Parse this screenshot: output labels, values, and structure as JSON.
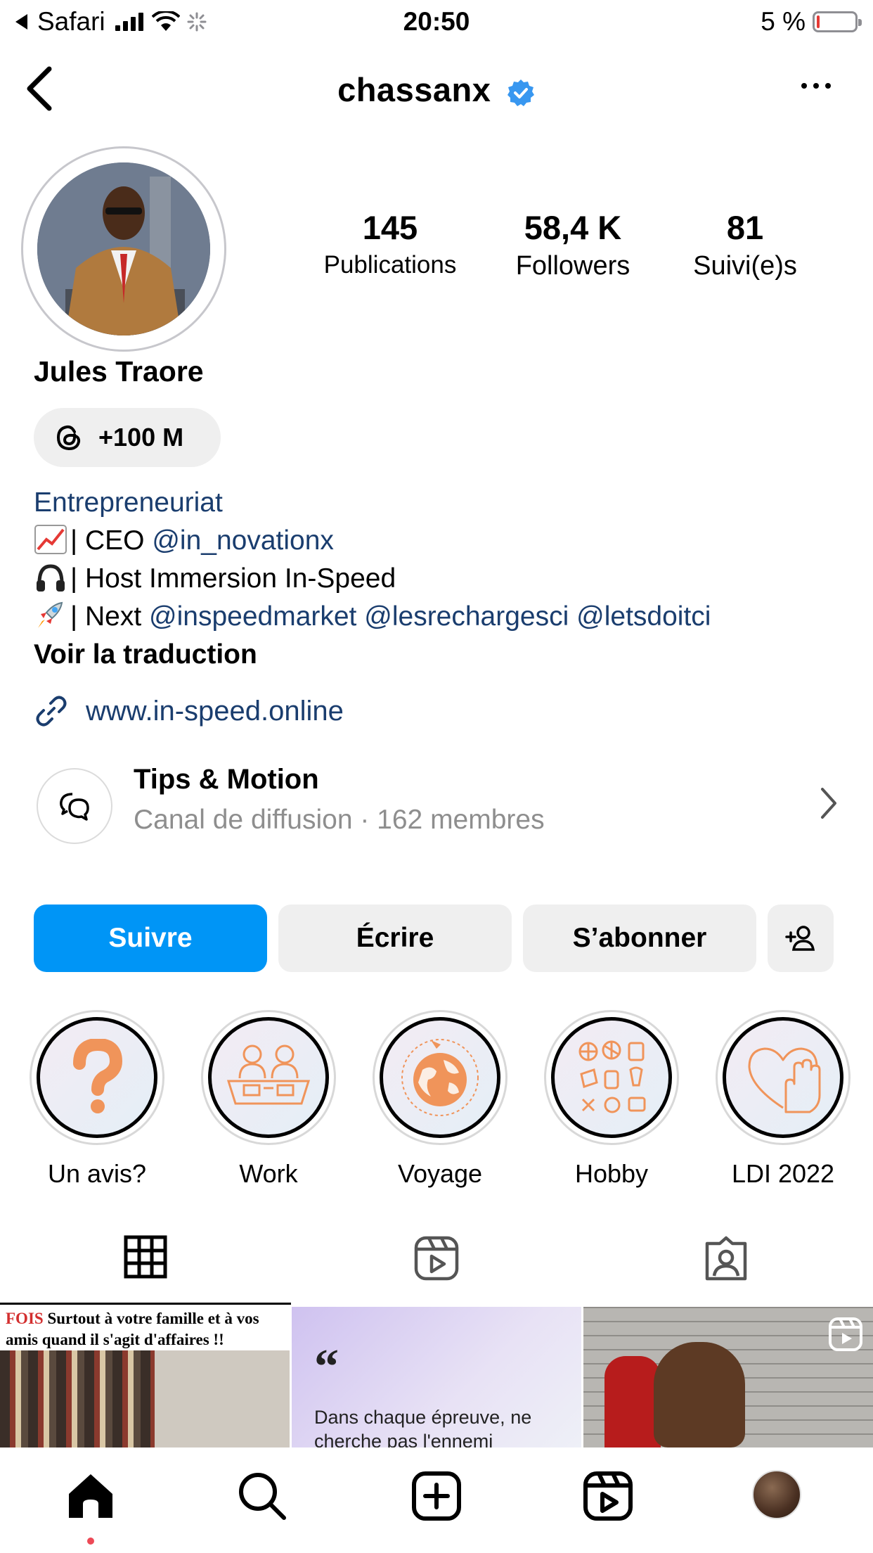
{
  "status_bar": {
    "carrier": "Safari",
    "time": "20:50",
    "battery_text": "5 %"
  },
  "header": {
    "username": "chassanx",
    "verified": true
  },
  "profile": {
    "stats": [
      {
        "value": "145",
        "label": "Publications"
      },
      {
        "value": "58,4 K",
        "label": "Followers"
      },
      {
        "value": "81",
        "label": "Suivi(e)s"
      }
    ],
    "full_name": "Jules Traore",
    "threads_badge": "+100 M",
    "bio": {
      "category": "Entrepreneuriat",
      "line1_prefix": "| CEO ",
      "line1_mention": "@in_novationx",
      "line2": "| Host Immersion In-Speed",
      "line3_prefix": "| Next ",
      "line3_mentions": [
        "@inspeedmarket",
        "@lesrechargesci",
        "@letsdoitci"
      ],
      "translate": "Voir la traduction"
    },
    "link": "www.in-speed.online",
    "channel": {
      "name": "Tips & Motion",
      "subtitle": "Canal de diffusion · 162 membres"
    }
  },
  "actions": {
    "follow": "Suivre",
    "message": "Écrire",
    "subscribe": "S’abonner"
  },
  "highlights": [
    {
      "label": "Un avis?",
      "icon": "question-mark-icon"
    },
    {
      "label": "Work",
      "icon": "meeting-table-icon"
    },
    {
      "label": "Voyage",
      "icon": "globe-plane-icon"
    },
    {
      "label": "Hobby",
      "icon": "sports-doodles-icon"
    },
    {
      "label": "LDI 2022",
      "icon": "heart-hand-icon"
    }
  ],
  "tabs": [
    "grid-icon",
    "reels-icon",
    "tagged-icon"
  ],
  "posts": [
    {
      "band_red": "FOIS",
      "band_text": " Surtout à votre famille et à vos amis quand il s'agit d'affaires !!"
    },
    {
      "quote_mark": "“",
      "text": "Dans chaque épreuve, ne cherche pas l'ennemi"
    },
    {
      "type": "reel"
    }
  ],
  "colors": {
    "primary_button": "#0095f6",
    "link_blue": "#1a3d6e",
    "secondary_button": "#efefef",
    "muted_text": "#8e8e8e",
    "notification_dot": "#ed4956"
  }
}
